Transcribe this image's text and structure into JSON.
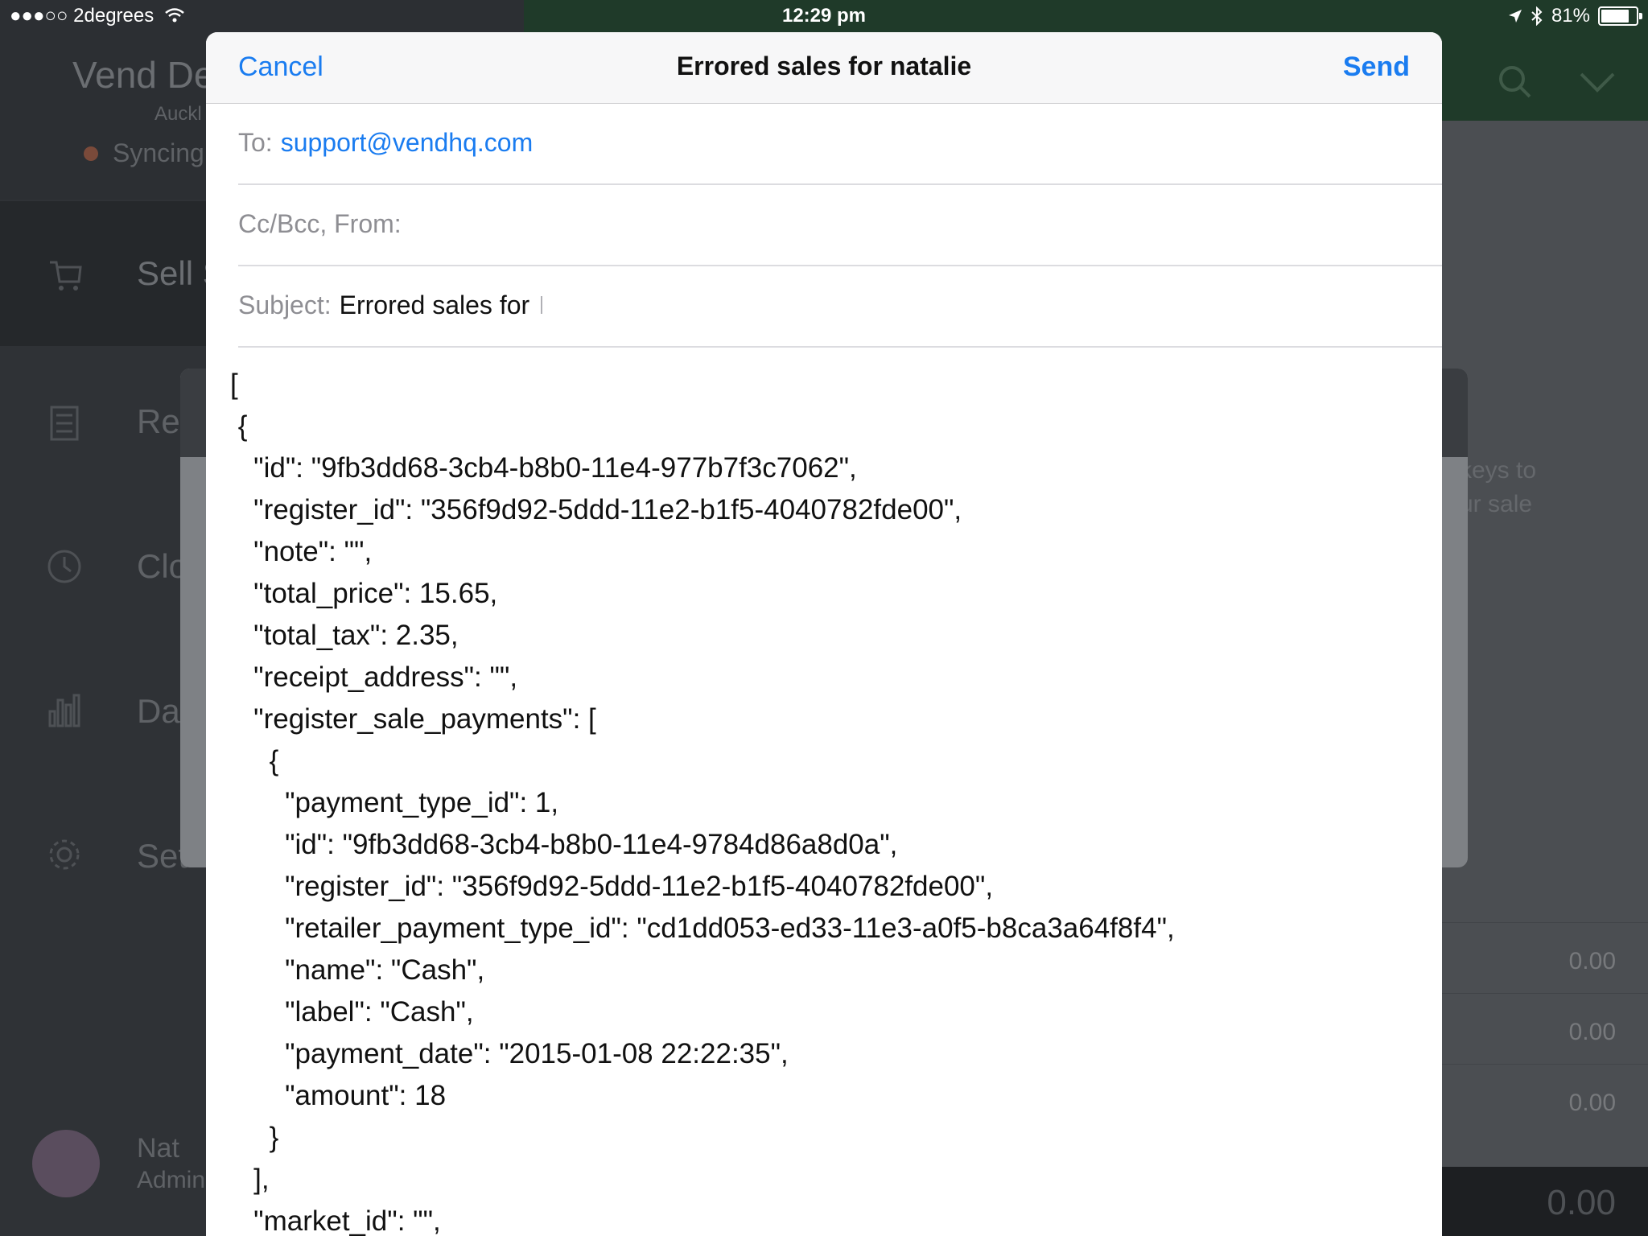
{
  "status_bar": {
    "carrier": "●●●○○ 2degrees",
    "time": "12:29 pm",
    "battery_text": "81%"
  },
  "background_app": {
    "store_title": "Vend De",
    "store_location": "Auckl",
    "sync_status": "Syncing",
    "nav": {
      "sell": "Sell S",
      "retail": "Ret",
      "close": "Clo",
      "dashboard": "Da",
      "settings": "Set"
    },
    "sheet_text_line1": "keys to",
    "sheet_text_line2": "ur sale",
    "amounts": [
      "0.00",
      "0.00",
      "0.00"
    ],
    "total": "0.00",
    "user_name": "Nat",
    "user_role": "Admin"
  },
  "compose": {
    "cancel_label": "Cancel",
    "title": "Errored sales for natalie",
    "send_label": "Send",
    "to_label": "To:",
    "to_value": "support@vendhq.com",
    "cc_label": "Cc/Bcc, From:",
    "subject_label": "Subject:",
    "subject_value": "Errored sales for",
    "body_text": "[\n {\n   \"id\": \"9fb3dd68-3cb4-b8b0-11e4-977b7f3c7062\",\n   \"register_id\": \"356f9d92-5ddd-11e2-b1f5-4040782fde00\",\n   \"note\": \"\",\n   \"total_price\": 15.65,\n   \"total_tax\": 2.35,\n   \"receipt_address\": \"\",\n   \"register_sale_payments\": [\n     {\n       \"payment_type_id\": 1,\n       \"id\": \"9fb3dd68-3cb4-b8b0-11e4-9784d86a8d0a\",\n       \"register_id\": \"356f9d92-5ddd-11e2-b1f5-4040782fde00\",\n       \"retailer_payment_type_id\": \"cd1dd053-ed33-11e3-a0f5-b8ca3a64f8f4\",\n       \"name\": \"Cash\",\n       \"label\": \"Cash\",\n       \"payment_date\": \"2015-01-08 22:22:35\",\n       \"amount\": 18\n     }\n   ],\n   \"market_id\": \"\","
  },
  "colors": {
    "accent": "#1a7cf0",
    "green_header": "#1f3a29"
  }
}
